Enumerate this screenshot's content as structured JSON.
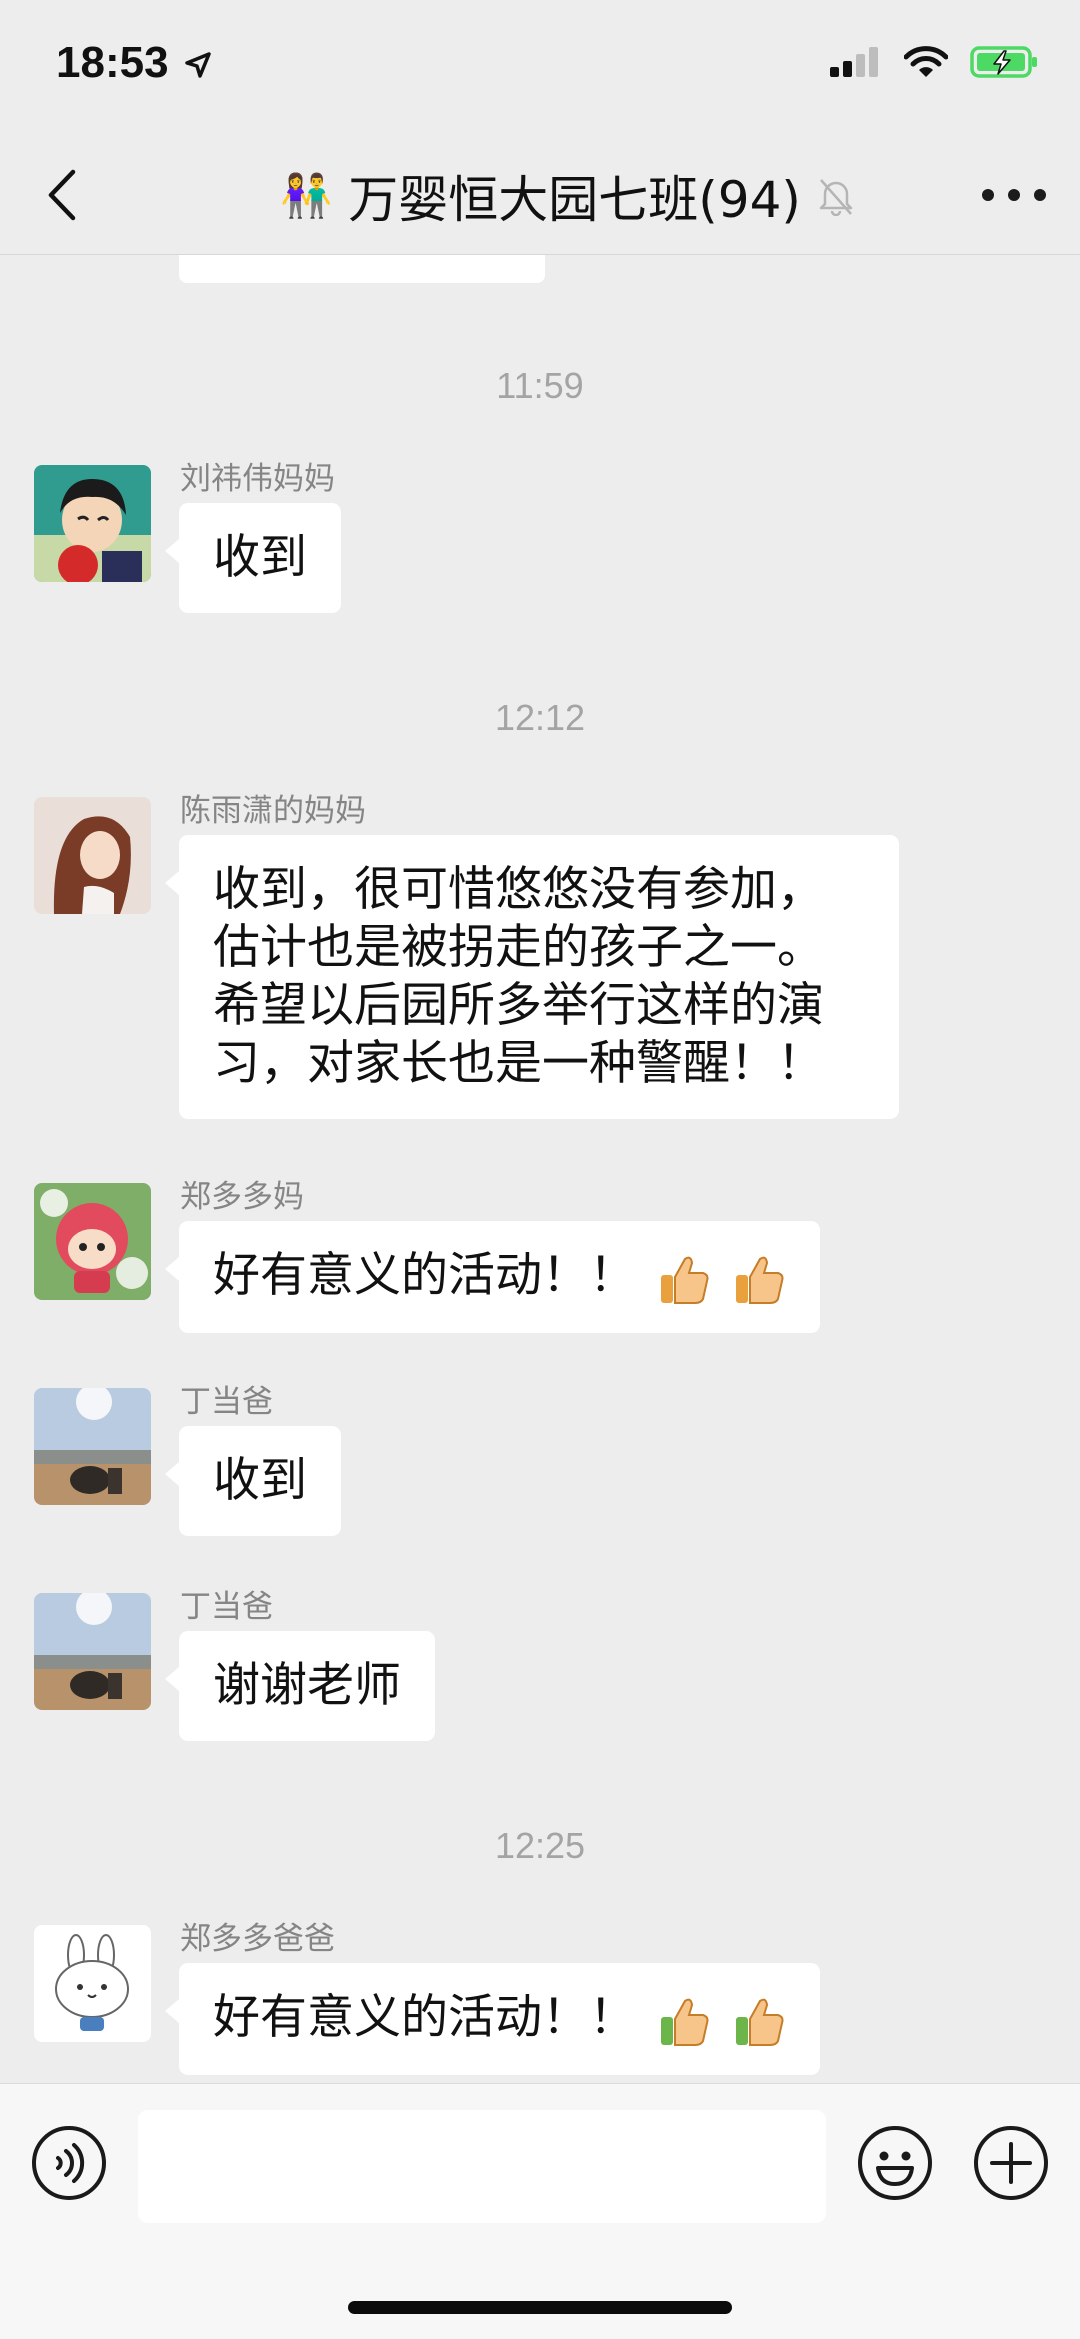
{
  "status_bar": {
    "time": "18:53"
  },
  "header": {
    "title": "万婴恒大园七班(94)",
    "emoji": "👫"
  },
  "timestamps": [
    "11:59",
    "12:12",
    "12:25"
  ],
  "messages": [
    {
      "sender": "刘祎伟妈妈",
      "text": "收到"
    },
    {
      "sender": "陈雨潇的妈妈",
      "lines": [
        "收到，很可惜悠悠没有参加，",
        "估计也是被拐走的孩子之一。",
        "希望以后园所多举行这样的演",
        "习，对家长也是一种警醒！！"
      ]
    },
    {
      "sender": "郑多多妈",
      "text": "好有意义的活动！！"
    },
    {
      "sender": "丁当爸",
      "text": "收到"
    },
    {
      "sender": "丁当爸",
      "text": "谢谢老师"
    },
    {
      "sender": "郑多多爸爸",
      "text": "好有意义的活动！！"
    }
  ],
  "input": {
    "placeholder": ""
  },
  "icons": {
    "back": "chevron-left-icon",
    "more": "more-dots-icon",
    "mute": "bell-off-icon",
    "voice": "voice-icon",
    "emoji": "emoji-smile-icon",
    "plus": "plus-circle-icon",
    "thumbs_up": "thumbs-up-emoji"
  },
  "colors": {
    "background": "#ededed",
    "bubble": "#ffffff",
    "battery": "#4cd964"
  }
}
